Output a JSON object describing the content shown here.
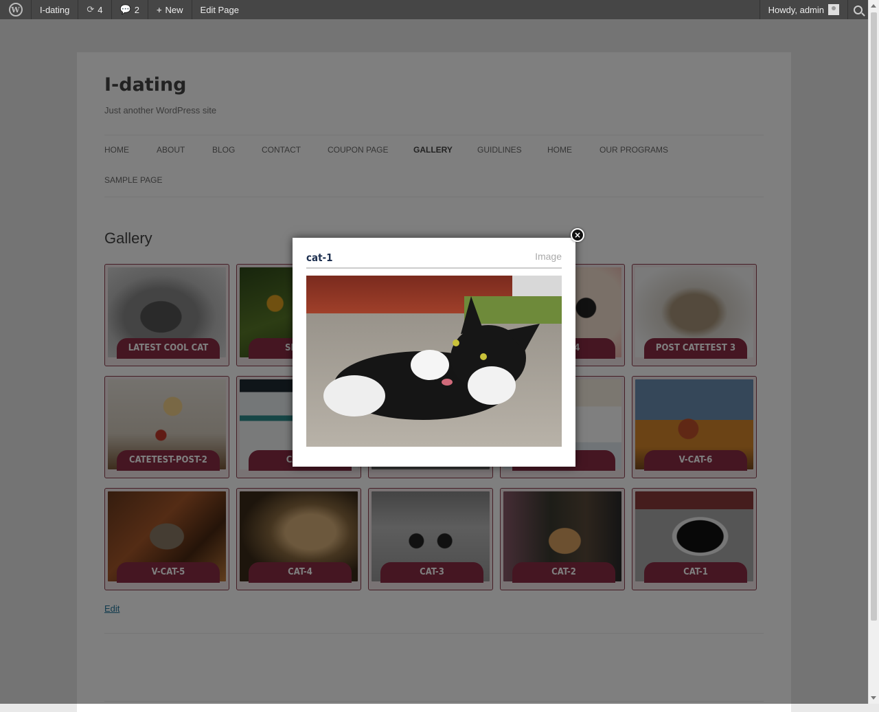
{
  "adminbar": {
    "site_name": "I-dating",
    "updates_count": "4",
    "comments_count": "2",
    "new_label": "New",
    "edit_label": "Edit Page",
    "howdy": "Howdy, admin"
  },
  "site": {
    "title": "I-dating",
    "description": "Just another WordPress site"
  },
  "nav": {
    "items": [
      {
        "label": "HOME"
      },
      {
        "label": "ABOUT"
      },
      {
        "label": "BLOG"
      },
      {
        "label": "CONTACT"
      },
      {
        "label": "COUPON PAGE"
      },
      {
        "label": "GALLERY",
        "active": true
      },
      {
        "label": "GUIDLINES"
      },
      {
        "label": "HOME"
      },
      {
        "label": "OUR PROGRAMS"
      },
      {
        "label": "SAMPLE PAGE"
      }
    ]
  },
  "page": {
    "heading": "Gallery",
    "edit_link": "Edit"
  },
  "gallery": {
    "items": [
      {
        "caption": "LATEST COOL CAT",
        "thumb": "cat-sitting-grey"
      },
      {
        "caption": "SMALL",
        "thumb": "yellow-flowers"
      },
      {
        "caption": "",
        "thumb": "hidden"
      },
      {
        "caption": "POST 4",
        "thumb": "cartoon-cat"
      },
      {
        "caption": "POST CATETEST 3",
        "thumb": "lynx-snow"
      },
      {
        "caption": "CATETEST-POST-2",
        "thumb": "girl-flowers"
      },
      {
        "caption": "CATET",
        "thumb": "website-screenshot"
      },
      {
        "caption": "",
        "thumb": "hidden"
      },
      {
        "caption": "-1",
        "thumb": "website-screenshot-2"
      },
      {
        "caption": "V-CAT-6",
        "thumb": "cartoon-scene"
      },
      {
        "caption": "V-CAT-5",
        "thumb": "lynx-leaves"
      },
      {
        "caption": "CAT-4",
        "thumb": "cougar"
      },
      {
        "caption": "CAT-3",
        "thumb": "cat-goggles"
      },
      {
        "caption": "CAT-2",
        "thumb": "cat-sunglasses-kids"
      },
      {
        "caption": "CAT-1",
        "thumb": "black-white-cat"
      }
    ]
  },
  "lightbox": {
    "title": "cat-1",
    "type_label": "Image"
  }
}
